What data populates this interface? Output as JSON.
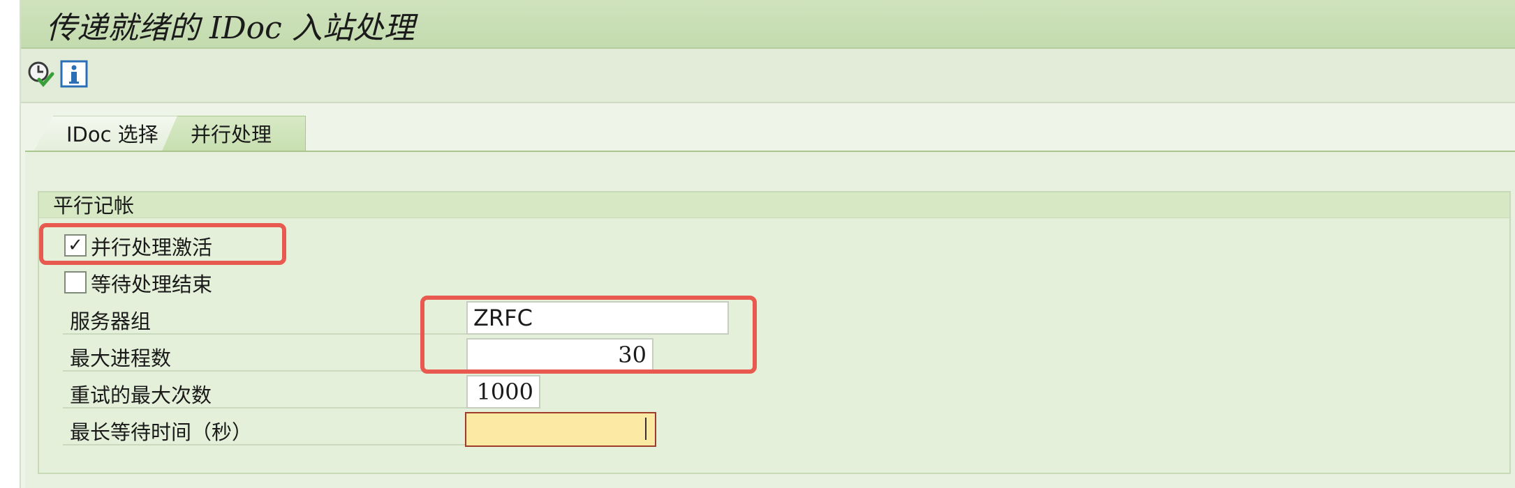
{
  "title": "传递就绪的 IDoc 入站处理",
  "toolbar": {
    "execute_icon": "clock-check-icon",
    "info_icon": "info-icon"
  },
  "tabs": [
    {
      "label": "IDoc 选择",
      "active": false
    },
    {
      "label": "并行处理",
      "active": true
    }
  ],
  "group": {
    "title": "平行记帐",
    "checkboxes": [
      {
        "label": "并行处理激活",
        "checked": true
      },
      {
        "label": "等待处理结束",
        "checked": false
      }
    ],
    "fields": [
      {
        "label": "服务器组",
        "value": "ZRFC"
      },
      {
        "label": "最大进程数",
        "value": "30"
      },
      {
        "label": "重试的最大次数",
        "value": "1000"
      },
      {
        "label": "最长等待时间（秒）",
        "value": ""
      }
    ]
  },
  "colors": {
    "header_green": "#c3dbae",
    "highlight": "#e85a4f",
    "focus_field": "#fce9a3"
  }
}
